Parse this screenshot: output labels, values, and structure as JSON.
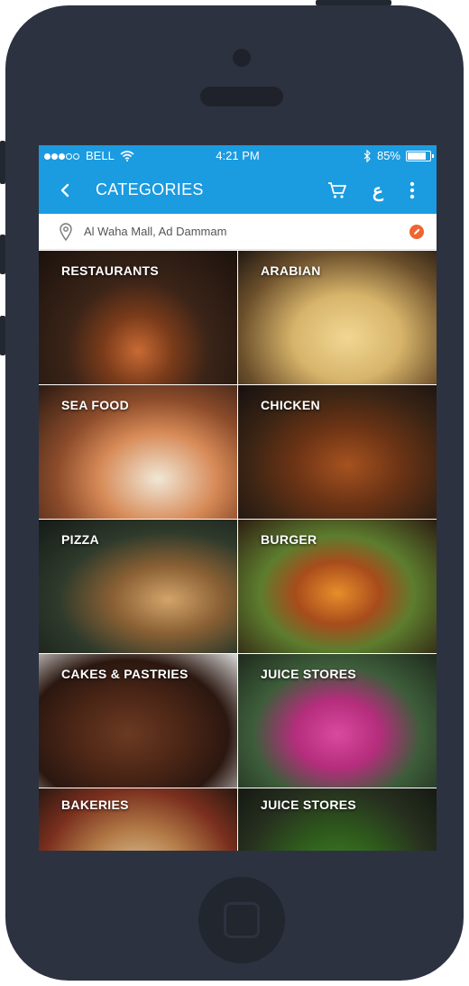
{
  "status_bar": {
    "carrier": "BELL",
    "time": "4:21 PM",
    "battery_percent": "85%",
    "battery_level": 0.85,
    "signal_bars_filled": 3,
    "signal_bars_total": 5
  },
  "header": {
    "title": "CATEGORIES",
    "language_toggle": "ع",
    "accent_color": "#1b9be0",
    "icons": [
      "back-arrow-icon",
      "cart-icon",
      "more-vertical-icon"
    ]
  },
  "location": {
    "text": "Al Waha Mall, Ad Dammam",
    "icons": [
      "location-pin-icon",
      "edit-pencil-icon"
    ],
    "edit_color": "#f0642f"
  },
  "categories": [
    {
      "label": "RESTAURANTS"
    },
    {
      "label": "ARABIAN"
    },
    {
      "label": "SEA FOOD"
    },
    {
      "label": "CHICKEN"
    },
    {
      "label": "PIZZA"
    },
    {
      "label": "BURGER"
    },
    {
      "label": "CAKES & PASTRIES"
    },
    {
      "label": "JUICE STORES"
    },
    {
      "label": "BAKERIES"
    },
    {
      "label": "JUICE STORES"
    }
  ]
}
